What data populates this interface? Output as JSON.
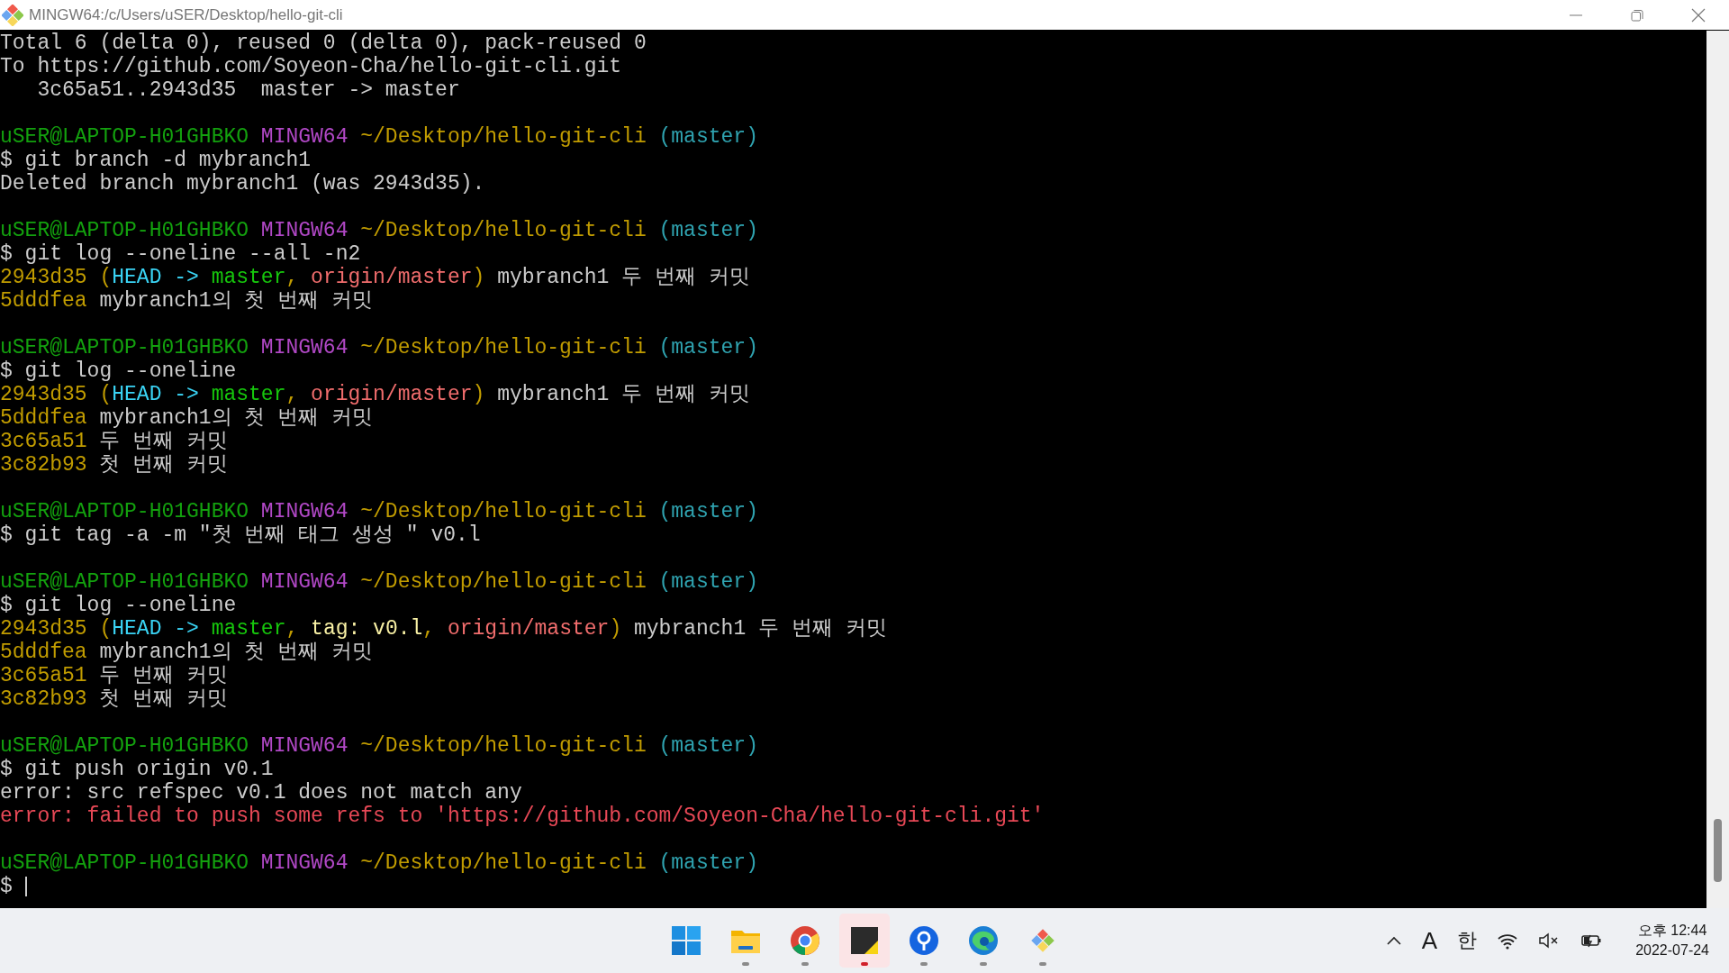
{
  "window": {
    "title": "MINGW64:/c/Users/uSER/Desktop/hello-git-cli"
  },
  "terminal": {
    "cursor": true,
    "lines": [
      {
        "kind": "text",
        "segments": [
          {
            "kind": "plain",
            "text": "Total 6 (delta 0), reused 0 (delta 0), pack-reused 0"
          }
        ]
      },
      {
        "kind": "text",
        "segments": [
          {
            "kind": "plain",
            "text": "To https://github.com/Soyeon-Cha/hello-git-cli.git"
          }
        ]
      },
      {
        "kind": "text",
        "segments": [
          {
            "kind": "plain",
            "text": "   3c65a51..2943d35  master -> master"
          }
        ]
      },
      {
        "kind": "blank"
      },
      {
        "kind": "text",
        "segments": [
          {
            "kind": "user",
            "text": "uSER@LAPTOP-H01GHBKO"
          },
          {
            "kind": "env",
            "text": "MINGW64"
          },
          {
            "kind": "path",
            "text": "~/Desktop/hello-git-cli"
          },
          {
            "kind": "branch",
            "text": "(master)"
          }
        ]
      },
      {
        "kind": "text",
        "segments": [
          {
            "kind": "plain",
            "text": "$ git branch -d mybranch1"
          }
        ]
      },
      {
        "kind": "text",
        "segments": [
          {
            "kind": "plain",
            "text": "Deleted branch mybranch1 (was 2943d35)."
          }
        ]
      },
      {
        "kind": "blank"
      },
      {
        "kind": "text",
        "segments": [
          {
            "kind": "user",
            "text": "uSER@LAPTOP-H01GHBKO"
          },
          {
            "kind": "env",
            "text": "MINGW64"
          },
          {
            "kind": "path",
            "text": "~/Desktop/hello-git-cli"
          },
          {
            "kind": "branch",
            "text": "(master)"
          }
        ]
      },
      {
        "kind": "text",
        "segments": [
          {
            "kind": "plain",
            "text": "$ git log --oneline --all -n2"
          }
        ]
      },
      {
        "kind": "text",
        "segments": [
          {
            "kind": "hash",
            "text": "2943d35 ("
          },
          {
            "kind": "head",
            "text": "HEAD -> "
          },
          {
            "kind": "local",
            "text": "master"
          },
          {
            "kind": "hash",
            "text": ", "
          },
          {
            "kind": "remote",
            "text": "origin/master"
          },
          {
            "kind": "hash",
            "text": ")"
          },
          {
            "kind": "plain",
            "text": " mybranch1 두 번째 커밋"
          }
        ]
      },
      {
        "kind": "text",
        "segments": [
          {
            "kind": "hash",
            "text": "5dddfea"
          },
          {
            "kind": "plain",
            "text": " mybranch1의 첫 번째 커밋"
          }
        ]
      },
      {
        "kind": "blank"
      },
      {
        "kind": "text",
        "segments": [
          {
            "kind": "user",
            "text": "uSER@LAPTOP-H01GHBKO"
          },
          {
            "kind": "env",
            "text": "MINGW64"
          },
          {
            "kind": "path",
            "text": "~/Desktop/hello-git-cli"
          },
          {
            "kind": "branch",
            "text": "(master)"
          }
        ]
      },
      {
        "kind": "text",
        "segments": [
          {
            "kind": "plain",
            "text": "$ git log --oneline"
          }
        ]
      },
      {
        "kind": "text",
        "segments": [
          {
            "kind": "hash",
            "text": "2943d35 ("
          },
          {
            "kind": "head",
            "text": "HEAD -> "
          },
          {
            "kind": "local",
            "text": "master"
          },
          {
            "kind": "hash",
            "text": ", "
          },
          {
            "kind": "remote",
            "text": "origin/master"
          },
          {
            "kind": "hash",
            "text": ")"
          },
          {
            "kind": "plain",
            "text": " mybranch1 두 번째 커밋"
          }
        ]
      },
      {
        "kind": "text",
        "segments": [
          {
            "kind": "hash",
            "text": "5dddfea"
          },
          {
            "kind": "plain",
            "text": " mybranch1의 첫 번째 커밋"
          }
        ]
      },
      {
        "kind": "text",
        "segments": [
          {
            "kind": "hash",
            "text": "3c65a51"
          },
          {
            "kind": "plain",
            "text": " 두 번째 커밋"
          }
        ]
      },
      {
        "kind": "text",
        "segments": [
          {
            "kind": "hash",
            "text": "3c82b93"
          },
          {
            "kind": "plain",
            "text": " 첫 번째 커밋"
          }
        ]
      },
      {
        "kind": "blank"
      },
      {
        "kind": "text",
        "segments": [
          {
            "kind": "user",
            "text": "uSER@LAPTOP-H01GHBKO"
          },
          {
            "kind": "env",
            "text": "MINGW64"
          },
          {
            "kind": "path",
            "text": "~/Desktop/hello-git-cli"
          },
          {
            "kind": "branch",
            "text": "(master)"
          }
        ]
      },
      {
        "kind": "text",
        "segments": [
          {
            "kind": "plain",
            "text": "$ git tag -a -m \"첫 번째 태그 생성 \" v0.l"
          }
        ]
      },
      {
        "kind": "blank"
      },
      {
        "kind": "text",
        "segments": [
          {
            "kind": "user",
            "text": "uSER@LAPTOP-H01GHBKO"
          },
          {
            "kind": "env",
            "text": "MINGW64"
          },
          {
            "kind": "path",
            "text": "~/Desktop/hello-git-cli"
          },
          {
            "kind": "branch",
            "text": "(master)"
          }
        ]
      },
      {
        "kind": "text",
        "segments": [
          {
            "kind": "plain",
            "text": "$ git log --oneline"
          }
        ]
      },
      {
        "kind": "text",
        "segments": [
          {
            "kind": "hash",
            "text": "2943d35 ("
          },
          {
            "kind": "head",
            "text": "HEAD -> "
          },
          {
            "kind": "local",
            "text": "master"
          },
          {
            "kind": "hash",
            "text": ", "
          },
          {
            "kind": "tag",
            "text": "tag: v0.l"
          },
          {
            "kind": "hash",
            "text": ", "
          },
          {
            "kind": "remote",
            "text": "origin/master"
          },
          {
            "kind": "hash",
            "text": ")"
          },
          {
            "kind": "plain",
            "text": " mybranch1 두 번째 커밋"
          }
        ]
      },
      {
        "kind": "text",
        "segments": [
          {
            "kind": "hash",
            "text": "5dddfea"
          },
          {
            "kind": "plain",
            "text": " mybranch1의 첫 번째 커밋"
          }
        ]
      },
      {
        "kind": "text",
        "segments": [
          {
            "kind": "hash",
            "text": "3c65a51"
          },
          {
            "kind": "plain",
            "text": " 두 번째 커밋"
          }
        ]
      },
      {
        "kind": "text",
        "segments": [
          {
            "kind": "hash",
            "text": "3c82b93"
          },
          {
            "kind": "plain",
            "text": " 첫 번째 커밋"
          }
        ]
      },
      {
        "kind": "blank"
      },
      {
        "kind": "text",
        "segments": [
          {
            "kind": "user",
            "text": "uSER@LAPTOP-H01GHBKO"
          },
          {
            "kind": "env",
            "text": "MINGW64"
          },
          {
            "kind": "path",
            "text": "~/Desktop/hello-git-cli"
          },
          {
            "kind": "branch",
            "text": "(master)"
          }
        ]
      },
      {
        "kind": "text",
        "segments": [
          {
            "kind": "plain",
            "text": "$ git push origin v0.1"
          }
        ]
      },
      {
        "kind": "text",
        "segments": [
          {
            "kind": "plain",
            "text": "error: src refspec v0.1 does not match any"
          }
        ]
      },
      {
        "kind": "text",
        "segments": [
          {
            "kind": "error",
            "text": "error: failed to push some refs to 'https://github.com/Soyeon-Cha/hello-git-cli.git'"
          }
        ]
      },
      {
        "kind": "blank"
      },
      {
        "kind": "text",
        "segments": [
          {
            "kind": "user",
            "text": "uSER@LAPTOP-H01GHBKO"
          },
          {
            "kind": "env",
            "text": "MINGW64"
          },
          {
            "kind": "path",
            "text": "~/Desktop/hello-git-cli"
          },
          {
            "kind": "branch",
            "text": "(master)"
          }
        ]
      },
      {
        "kind": "input",
        "segments": [
          {
            "kind": "plain",
            "text": "$"
          }
        ]
      }
    ]
  },
  "taskbar": {
    "apps": [
      {
        "kind": "start",
        "active": false
      },
      {
        "kind": "folder",
        "running": true,
        "active": false
      },
      {
        "kind": "browser",
        "running": true,
        "active": false
      },
      {
        "kind": "notes",
        "running": true,
        "active": true
      },
      {
        "kind": "pin",
        "running": true,
        "active": false
      },
      {
        "kind": "wave",
        "running": true,
        "active": false
      },
      {
        "kind": "git",
        "running": true,
        "active": false
      }
    ],
    "tray": {
      "ime_mode": "A",
      "ime_lang": "한",
      "time": "오후 12:44",
      "date": "2022-07-24"
    }
  }
}
